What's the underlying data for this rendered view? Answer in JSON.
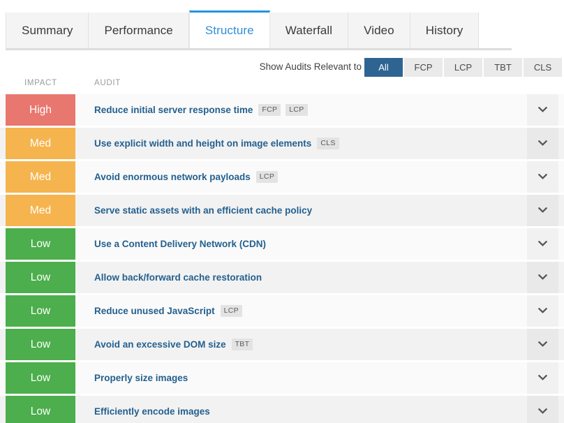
{
  "tabs": [
    {
      "label": "Summary",
      "active": false
    },
    {
      "label": "Performance",
      "active": false
    },
    {
      "label": "Structure",
      "active": true
    },
    {
      "label": "Waterfall",
      "active": false
    },
    {
      "label": "Video",
      "active": false
    },
    {
      "label": "History",
      "active": false
    }
  ],
  "filter": {
    "label": "Show Audits Relevant to",
    "options": [
      {
        "label": "All",
        "selected": true
      },
      {
        "label": "FCP",
        "selected": false
      },
      {
        "label": "LCP",
        "selected": false
      },
      {
        "label": "TBT",
        "selected": false
      },
      {
        "label": "CLS",
        "selected": false
      }
    ]
  },
  "columns": {
    "impact": "IMPACT",
    "audit": "AUDIT"
  },
  "colors": {
    "accent_blue": "#2196e0",
    "selected_button": "#2e6491",
    "link_blue": "#24608f",
    "impact_high": "#e8776f",
    "impact_med": "#f5b44e",
    "impact_low": "#4cae4c"
  },
  "icons": {
    "expand": "chevron-down-icon"
  },
  "audits": [
    {
      "impact": "High",
      "impact_level": "high",
      "title": "Reduce initial server response time",
      "metrics": [
        "FCP",
        "LCP"
      ]
    },
    {
      "impact": "Med",
      "impact_level": "med",
      "title": "Use explicit width and height on image elements",
      "metrics": [
        "CLS"
      ]
    },
    {
      "impact": "Med",
      "impact_level": "med",
      "title": "Avoid enormous network payloads",
      "metrics": [
        "LCP"
      ]
    },
    {
      "impact": "Med",
      "impact_level": "med",
      "title": "Serve static assets with an efficient cache policy",
      "metrics": []
    },
    {
      "impact": "Low",
      "impact_level": "low",
      "title": "Use a Content Delivery Network (CDN)",
      "metrics": []
    },
    {
      "impact": "Low",
      "impact_level": "low",
      "title": "Allow back/forward cache restoration",
      "metrics": []
    },
    {
      "impact": "Low",
      "impact_level": "low",
      "title": "Reduce unused JavaScript",
      "metrics": [
        "LCP"
      ]
    },
    {
      "impact": "Low",
      "impact_level": "low",
      "title": "Avoid an excessive DOM size",
      "metrics": [
        "TBT"
      ]
    },
    {
      "impact": "Low",
      "impact_level": "low",
      "title": "Properly size images",
      "metrics": []
    },
    {
      "impact": "Low",
      "impact_level": "low",
      "title": "Efficiently encode images",
      "metrics": []
    }
  ]
}
